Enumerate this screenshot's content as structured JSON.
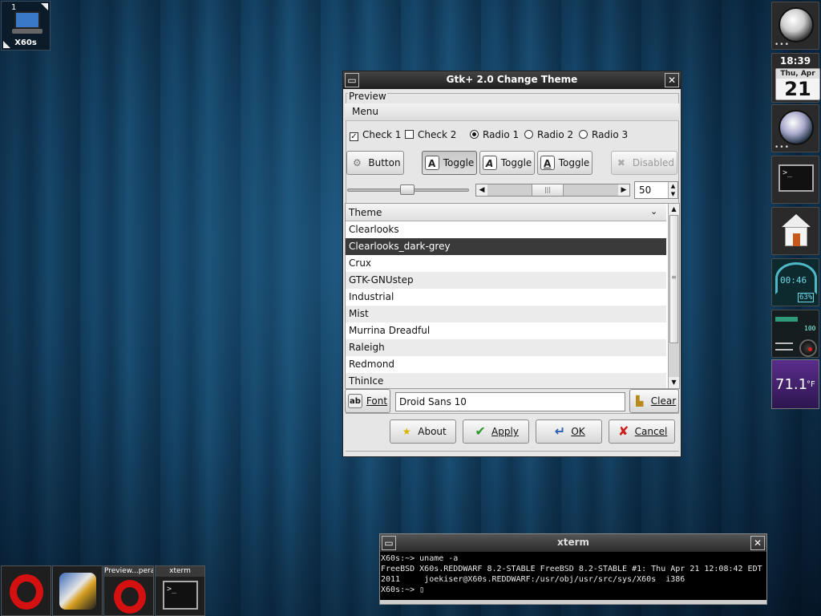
{
  "pager": {
    "workspace_number": "1",
    "label": "X60s"
  },
  "dialog": {
    "title": "Gtk+ 2.0 Change Theme",
    "preview_label": "Preview",
    "menu_label": "Menu",
    "checks": [
      {
        "label": "Check 1",
        "checked": true
      },
      {
        "label": "Check 2",
        "checked": false
      }
    ],
    "radios": [
      {
        "label": "Radio 1",
        "selected": true
      },
      {
        "label": "Radio 2",
        "selected": false
      },
      {
        "label": "Radio 3",
        "selected": false
      }
    ],
    "buttons": {
      "button": "Button",
      "toggle_1": "Toggle",
      "toggle_2": "Toggle",
      "toggle_3": "Toggle",
      "disabled": "Disabled"
    },
    "slider_value_fraction": 0.5,
    "spin_value": "50",
    "theme_column_header": "Theme",
    "themes": [
      "Clearlooks",
      "Clearlooks_dark-grey",
      "Crux",
      "GTK-GNUstep",
      "Industrial",
      "Mist",
      "Murrina Dreadful",
      "Raleigh",
      "Redmond",
      "ThinIce"
    ],
    "selected_theme": "Clearlooks_dark-grey",
    "font_button": "Font",
    "font_value": "Droid Sans 10",
    "clear_button": "Clear",
    "about_button": "About",
    "apply_button": "Apply",
    "ok_button": "OK",
    "cancel_button": "Cancel"
  },
  "dock": {
    "clock_time": "18:39",
    "calendar_header": "Thu, Apr",
    "calendar_day": "21",
    "battery_time": "00:46",
    "battery_percent": "63%",
    "volume_level": "100",
    "temperature": "71.1",
    "temperature_unit": "°F"
  },
  "taskbar": {
    "item_3_caption": "Preview...pera",
    "item_4_caption": "xterm"
  },
  "xterm": {
    "title": "xterm",
    "lines": [
      "X60s:~> uname -a",
      "FreeBSD X60s.REDDWARF 8.2-STABLE FreeBSD 8.2-STABLE #1: Thu Apr 21 12:08:42 EDT",
      "2011     joekiser@X60s.REDDWARF:/usr/obj/usr/src/sys/X60s  i386",
      "X60s:~> ▯"
    ]
  },
  "colors": {
    "desktop_blue": "#123d5c",
    "selection": "#3a3a3a",
    "opera_red": "#d41010",
    "weather_purple": "#5a2d8a"
  }
}
